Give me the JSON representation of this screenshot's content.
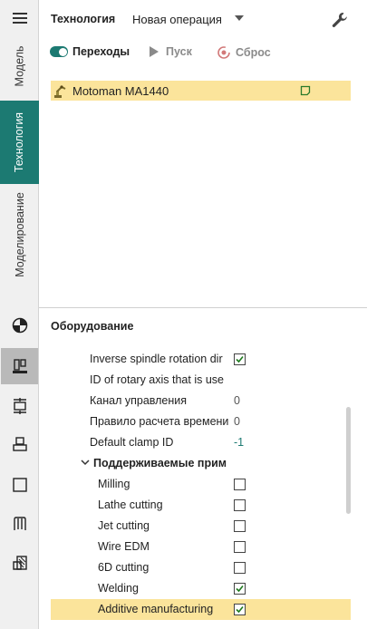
{
  "rail": {
    "tabs": [
      {
        "label": "Модель"
      },
      {
        "label": "Технология"
      },
      {
        "label": "Моделирование"
      }
    ]
  },
  "header": {
    "title": "Технология",
    "operation": "Новая операция"
  },
  "toolbar": {
    "transitions_label": "Переходы",
    "run_label": "Пуск",
    "reset_label": "Сброс"
  },
  "tree": {
    "item_label": "Motoman MA1440"
  },
  "properties": {
    "title": "Оборудование",
    "rows": [
      {
        "label": "Inverse spindle rotation dir",
        "value": "",
        "checked": true
      },
      {
        "label": "ID of rotary axis that is use",
        "value": ""
      },
      {
        "label": "Канал управления",
        "value": "0"
      },
      {
        "label": "Правило расчета времени",
        "value": "0"
      },
      {
        "label": "Default clamp ID",
        "value": "-1"
      }
    ],
    "group_label": "Поддерживаемые прим",
    "sub_rows": [
      {
        "label": "Milling",
        "checked": false
      },
      {
        "label": "Lathe cutting",
        "checked": false
      },
      {
        "label": "Jet cutting",
        "checked": false
      },
      {
        "label": "Wire EDM",
        "checked": false
      },
      {
        "label": "6D cutting",
        "checked": false
      },
      {
        "label": "Welding",
        "checked": true
      },
      {
        "label": "Additive manufacturing",
        "checked": true
      }
    ]
  },
  "colors": {
    "accent": "#1c7a72",
    "highlight": "#fbe49b",
    "rail_bg": "#f0f0f0"
  }
}
